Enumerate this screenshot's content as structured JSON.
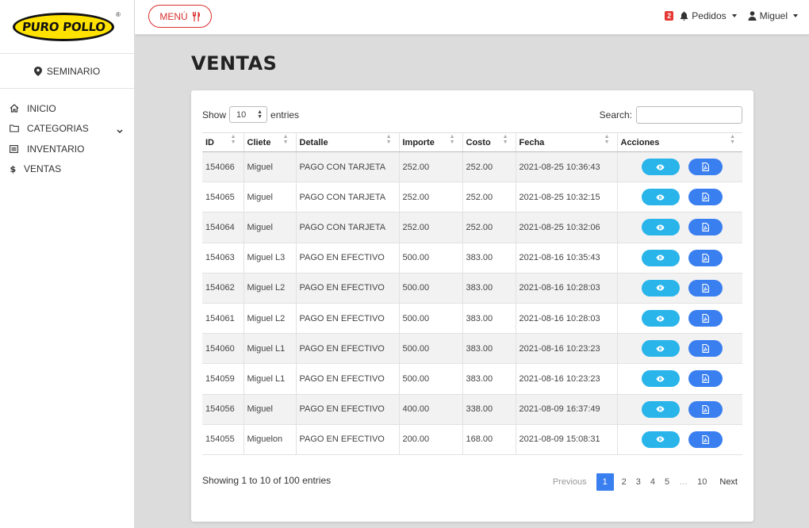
{
  "brand": {
    "logo_text": "PURO POLLO",
    "reg_mark": "®"
  },
  "branch": {
    "name": "SEMINARIO"
  },
  "sidebar": {
    "items": [
      {
        "label": "INICIO",
        "icon": "home-icon"
      },
      {
        "label": "CATEGORIAS",
        "icon": "folder-icon",
        "has_submenu": true
      },
      {
        "label": "INVENTARIO",
        "icon": "list-icon"
      },
      {
        "label": "VENTAS",
        "icon": "dollar-icon"
      }
    ]
  },
  "topbar": {
    "menu_label": "MENÚ",
    "orders_badge": "2",
    "orders_label": "Pedidos",
    "user_label": "Miguel"
  },
  "page": {
    "title": "VENTAS"
  },
  "table_controls": {
    "show_label": "Show",
    "entries_label": "entries",
    "page_size": "10",
    "search_label": "Search:",
    "search_value": ""
  },
  "table": {
    "headers": [
      "ID",
      "Cliete",
      "Detalle",
      "Importe",
      "Costo",
      "Fecha",
      "Acciones"
    ],
    "rows": [
      [
        "154066",
        "Miguel",
        "PAGO CON TARJETA",
        "252.00",
        "252.00",
        "2021-08-25 10:36:43"
      ],
      [
        "154065",
        "Miguel",
        "PAGO CON TARJETA",
        "252.00",
        "252.00",
        "2021-08-25 10:32:15"
      ],
      [
        "154064",
        "Miguel",
        "PAGO CON TARJETA",
        "252.00",
        "252.00",
        "2021-08-25 10:32:06"
      ],
      [
        "154063",
        "Miguel L3",
        "PAGO EN EFECTIVO",
        "500.00",
        "383.00",
        "2021-08-16 10:35:43"
      ],
      [
        "154062",
        "Miguel L2",
        "PAGO EN EFECTIVO",
        "500.00",
        "383.00",
        "2021-08-16 10:28:03"
      ],
      [
        "154061",
        "Miguel L2",
        "PAGO EN EFECTIVO",
        "500.00",
        "383.00",
        "2021-08-16 10:28:03"
      ],
      [
        "154060",
        "Miguel L1",
        "PAGO EN EFECTIVO",
        "500.00",
        "383.00",
        "2021-08-16 10:23:23"
      ],
      [
        "154059",
        "Miguel L1",
        "PAGO EN EFECTIVO",
        "500.00",
        "383.00",
        "2021-08-16 10:23:23"
      ],
      [
        "154056",
        "Miguel",
        "PAGO EN EFECTIVO",
        "400.00",
        "338.00",
        "2021-08-09 16:37:49"
      ],
      [
        "154055",
        "Miguelon",
        "PAGO EN EFECTIVO",
        "200.00",
        "168.00",
        "2021-08-09 15:08:31"
      ]
    ]
  },
  "footer": {
    "info": "Showing 1 to 10 of 100 entries",
    "previous_label": "Previous",
    "pages": [
      "1",
      "2",
      "3",
      "4",
      "5",
      "…",
      "10"
    ],
    "current_page": "1",
    "next_label": "Next"
  },
  "colors": {
    "brand_yellow": "#ffe200",
    "menu_red": "#d9302d",
    "view_button": "#29b4ea",
    "pdf_button": "#3a7ff0",
    "badge_red": "#e53935"
  }
}
